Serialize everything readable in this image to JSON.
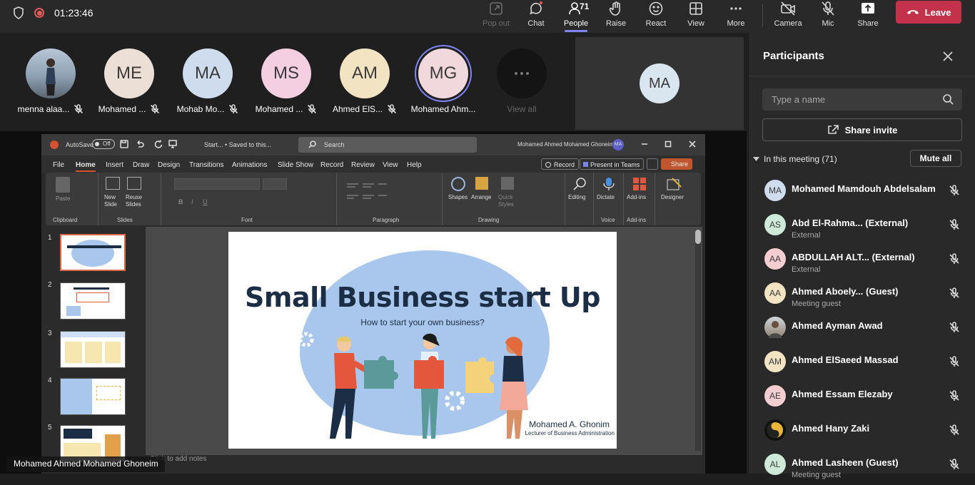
{
  "topbar": {
    "timer": "01:23:46",
    "buttons": [
      {
        "name": "popout",
        "label": "Pop out"
      },
      {
        "name": "chat",
        "label": "Chat"
      },
      {
        "name": "people",
        "label": "People",
        "count": "71"
      },
      {
        "name": "raise",
        "label": "Raise"
      },
      {
        "name": "react",
        "label": "React"
      },
      {
        "name": "view",
        "label": "View"
      },
      {
        "name": "more",
        "label": "More"
      },
      {
        "name": "camera",
        "label": "Camera"
      },
      {
        "name": "mic",
        "label": "Mic"
      },
      {
        "name": "share",
        "label": "Share"
      }
    ],
    "leave_label": "Leave",
    "leave_color": "#c4314b"
  },
  "strip": {
    "tiles": [
      {
        "initials": "",
        "name": "menna alaa...",
        "color": "#8a9bb0"
      },
      {
        "initials": "ME",
        "name": "Mohamed ...",
        "color": "#ecdfd6"
      },
      {
        "initials": "MA",
        "name": "Mohab Mo...",
        "color": "#cfdcee"
      },
      {
        "initials": "MS",
        "name": "Mohamed ...",
        "color": "#f3cfe1"
      },
      {
        "initials": "AM",
        "name": "Ahmed ElS...",
        "color": "#f2e4c2"
      },
      {
        "initials": "MG",
        "name": "Mohamed Ahm...",
        "color": "#f0d8dc"
      }
    ],
    "view_all": "View all",
    "right_tile_initials": "MA"
  },
  "ppt": {
    "autosave": "AutoSave",
    "autosave_state": "Off",
    "doc_title": "Start... • Saved to this...",
    "search": "Search",
    "user": "Mohamed Ahmed Mohamed Ghoneim",
    "user_initials": "MA",
    "tabs": [
      "File",
      "Home",
      "Insert",
      "Draw",
      "Design",
      "Transitions",
      "Animations",
      "Slide Show",
      "Record",
      "Review",
      "View",
      "Help"
    ],
    "record_btn": "Record",
    "present_btn": "Present in Teams",
    "share_btn": "Share",
    "groups": [
      "Clipboard",
      "Slides",
      "Font",
      "Paragraph",
      "Drawing",
      "Voice",
      "Add-ins"
    ],
    "ribbon_items": [
      "Paste",
      "New Slide",
      "Reuse Slides",
      "Shapes",
      "Arrange",
      "Quick Styles",
      "Editing",
      "Dictate",
      "Add-ins",
      "Designer"
    ],
    "slide_numbers": [
      "1",
      "2",
      "3",
      "4",
      "5"
    ],
    "notes": "Click to add notes"
  },
  "slide": {
    "title": "Small Business start Up",
    "subtitle": "How to start your own business?",
    "author": "Mohamed A. Ghonim",
    "role": "Lecturer of Business Administration"
  },
  "caption": "Mohamed Ahmed Mohamed Ghoneim",
  "panel": {
    "title": "Participants",
    "search_placeholder": "Type a name",
    "invite": "Share invite",
    "in_meeting": "In this meeting (71)",
    "mute_all": "Mute all",
    "people": [
      {
        "initials": "MA",
        "name": "Mohamed Mamdouh Abdelsalam",
        "sub": "",
        "color": "#cfdcee"
      },
      {
        "initials": "AS",
        "name": "Abd El-Rahma...  (External)",
        "sub": "External",
        "color": "#cfe9d9"
      },
      {
        "initials": "AA",
        "name": "ABDULLAH ALT...  (External)",
        "sub": "External",
        "color": "#f4cdd0"
      },
      {
        "initials": "AA",
        "name": "Ahmed Aboely...  (Guest)",
        "sub": "Meeting guest",
        "color": "#f2e4c2"
      },
      {
        "initials": "",
        "name": "Ahmed Ayman Awad",
        "sub": "",
        "color": "#9a8a7a"
      },
      {
        "initials": "AM",
        "name": "Ahmed ElSaeed Massad",
        "sub": "",
        "color": "#f2e4c2"
      },
      {
        "initials": "AE",
        "name": "Ahmed Essam Elezaby",
        "sub": "",
        "color": "#f4cdd0"
      },
      {
        "initials": "",
        "name": "Ahmed Hany Zaki",
        "sub": "",
        "color": "#222222"
      },
      {
        "initials": "AL",
        "name": "Ahmed Lasheen (Guest)",
        "sub": "Meeting guest",
        "color": "#cfe9d9"
      }
    ]
  }
}
